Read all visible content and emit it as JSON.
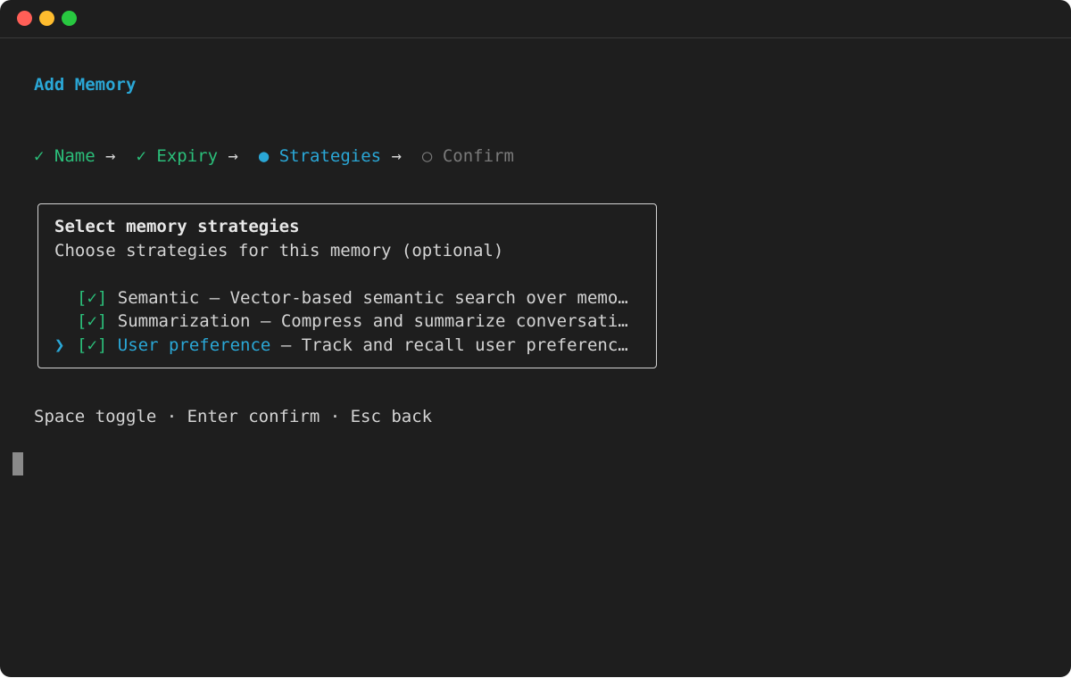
{
  "window": {
    "traffic_lights": [
      "close",
      "minimize",
      "zoom"
    ]
  },
  "title": "Add Memory",
  "steps": [
    {
      "icon": "✓",
      "label": "Name",
      "state": "done"
    },
    {
      "icon": "✓",
      "label": "Expiry",
      "state": "done"
    },
    {
      "icon": "●",
      "label": "Strategies",
      "state": "active"
    },
    {
      "icon": "○",
      "label": "Confirm",
      "state": "pending"
    }
  ],
  "step_separator": "→",
  "panel": {
    "heading": "Select memory strategies",
    "subheading": "Choose strategies for this memory (optional)",
    "options": [
      {
        "pointer": " ",
        "checkbox": "[✓]",
        "name": "Semantic",
        "description": " – Vector-based semantic search over memo…",
        "selected": false
      },
      {
        "pointer": " ",
        "checkbox": "[✓]",
        "name": "Summarization",
        "description": " – Compress and summarize conversati…",
        "selected": false
      },
      {
        "pointer": "❯",
        "checkbox": "[✓]",
        "name": "User preference",
        "description": " – Track and recall user preferenc…",
        "selected": true
      }
    ]
  },
  "help_text": "Space toggle · Enter confirm · Esc back",
  "colors": {
    "background": "#1e1e1e",
    "accent": "#2aa7d6",
    "done": "#2bbf7a",
    "pending": "#7a7a7a",
    "text": "#d4d4d4"
  }
}
